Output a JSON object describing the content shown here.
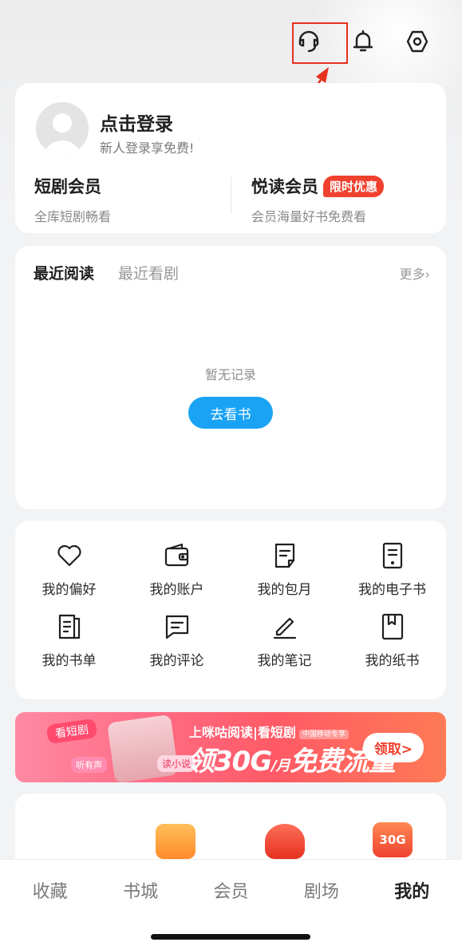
{
  "header": {
    "icons": [
      "headset-icon",
      "bell-icon",
      "settings-icon"
    ]
  },
  "user": {
    "login_title": "点击登录",
    "login_sub": "新人登录享免费!",
    "vip_left_title": "短剧会员",
    "vip_left_sub": "全库短剧畅看",
    "vip_right_title": "悦读会员",
    "vip_right_tag": "限时优惠",
    "vip_right_sub": "会员海量好书免费看"
  },
  "recent": {
    "tabs": [
      "最近阅读",
      "最近看剧"
    ],
    "more": "更多",
    "empty": "暂无记录",
    "button": "去看书"
  },
  "grid": [
    {
      "label": "我的偏好",
      "icon": "heart-icon"
    },
    {
      "label": "我的账户",
      "icon": "wallet-icon"
    },
    {
      "label": "我的包月",
      "icon": "subscription-icon"
    },
    {
      "label": "我的电子书",
      "icon": "ebook-icon"
    },
    {
      "label": "我的书单",
      "icon": "booklist-icon"
    },
    {
      "label": "我的评论",
      "icon": "comment-icon"
    },
    {
      "label": "我的笔记",
      "icon": "note-icon"
    },
    {
      "label": "我的纸书",
      "icon": "paper-book-icon"
    }
  ],
  "banner": {
    "tag_watch": "看短剧",
    "tag_listen": "听有声",
    "tag_read": "读小说",
    "line1": "上咪咕阅读|看短剧",
    "line1_small": "中国移动专享",
    "line2_a": "领30G",
    "line2_unit": "/月",
    "line2_b": "免费流量",
    "button": "领取>"
  },
  "bottom_card": {
    "gift3": "30G"
  },
  "tabbar": [
    "收藏",
    "书城",
    "会员",
    "剧场",
    "我的"
  ],
  "tabbar_active": 4,
  "colors": {
    "accent_blue": "#1aa3f5",
    "accent_red": "#f0412f",
    "annotation_red": "#e5321f"
  }
}
